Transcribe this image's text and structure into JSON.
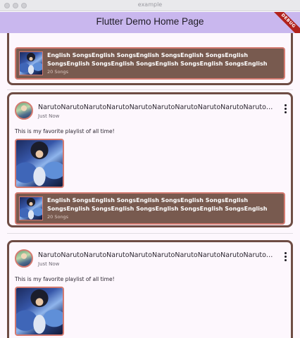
{
  "window": {
    "title": "example"
  },
  "appbar": {
    "title": "Flutter Demo Home Page",
    "debug_banner": "DEBUG"
  },
  "posts": [
    {
      "playlist": {
        "title": "English SongsEnglish SongsEnglish SongsEnglish SongsEnglish SongsEnglish SongsEnglish SongsEnglish SongsEnglish SongsEnglish Songs...",
        "count": "20 Songs"
      }
    },
    {
      "username": "NarutoNarutoNarutoNarutoNarutoNarutoNarutoNarutoNarutoNarutoNarutoNarutoN...",
      "time": "Just Now",
      "text": "This is my favorite playlist of all time!",
      "playlist": {
        "title": "English SongsEnglish SongsEnglish SongsEnglish SongsEnglish SongsEnglish SongsEnglish SongsEnglish SongsEnglish SongsEnglish Songs",
        "count": "20 Songs"
      }
    },
    {
      "username": "NarutoNarutoNarutoNarutoNarutoNarutoNarutoNarutoNarutoNarutoNarutoNarutoN...",
      "time": "Just Now",
      "text": "This is my favorite playlist of all time!"
    }
  ],
  "colors": {
    "appbar": "#c9b7ee",
    "card_border": "#6e4c44",
    "playlist_bg": "#785a4f",
    "accent_border": "#d47a70",
    "background": "#fdf7fd"
  },
  "icons": [
    "more-vert-icon"
  ]
}
